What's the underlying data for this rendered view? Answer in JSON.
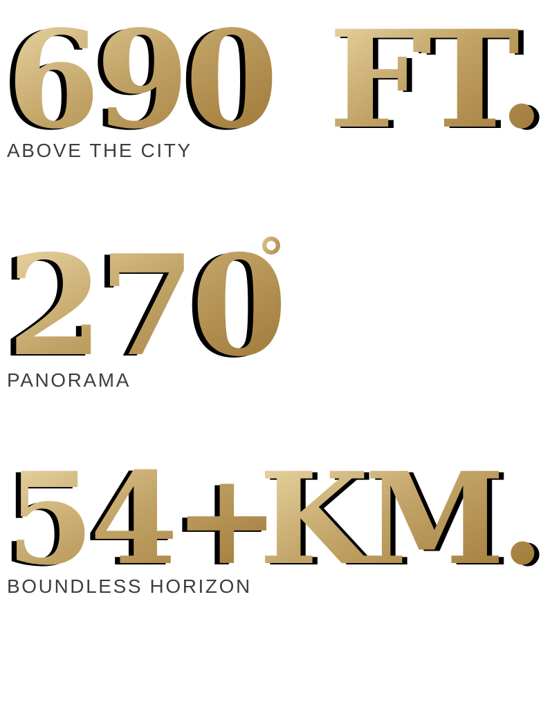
{
  "colors": {
    "gold_light": "#eedcaa",
    "gold_mid": "#c2a468",
    "gold_dark": "#9a7230",
    "shadow": "#000000",
    "caption": "#3e3e3e"
  },
  "stats": [
    {
      "figure": "690",
      "unit": "FT.",
      "caption": "ABOVE THE CITY"
    },
    {
      "figure": "270",
      "unit": "°",
      "caption": "PANORAMA"
    },
    {
      "figure": "54+",
      "unit": "KM.",
      "caption": "BOUNDLESS HORIZON"
    }
  ]
}
